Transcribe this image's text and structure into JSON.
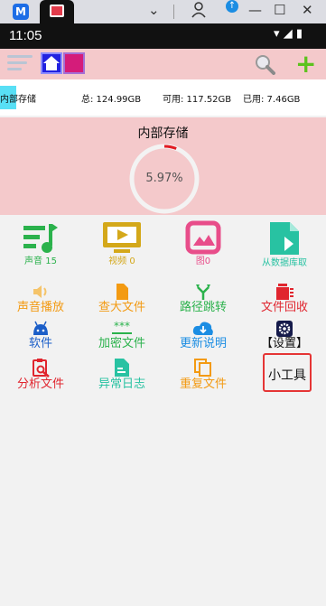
{
  "emulator": {
    "app_badge": "M",
    "controls": {
      "chevron": "⌄",
      "minimize": "—",
      "maximize": "☐",
      "close": "✕"
    }
  },
  "status_bar": {
    "time": "11:05",
    "icons": "▾ ◢ ▮"
  },
  "storage": {
    "name": "内部存储",
    "total": "总: 124.99GB",
    "free": "可用: 117.52GB",
    "used": "已用: 7.46GB",
    "panel_title": "内部存储",
    "percent_text": "5.97%",
    "percent_value": 5.97
  },
  "grid": [
    {
      "label": "声音 15",
      "color": "#2bb24c",
      "icon": "music-icon"
    },
    {
      "label": "视频 0",
      "color": "#d4a81a",
      "icon": "video-icon"
    },
    {
      "label": "图0",
      "color": "#e84d8a",
      "icon": "image-icon"
    },
    {
      "label": "从数据库取",
      "color": "#28c2a2",
      "icon": "database-file-icon"
    },
    {
      "label": "声音播放",
      "color": "#f39a12",
      "icon": "volume-icon"
    },
    {
      "label": "查大文件",
      "color": "#f39a12",
      "icon": "file-icon"
    },
    {
      "label": "路径跳转",
      "color": "#2bb24c",
      "icon": "fork-icon"
    },
    {
      "label": "文件回收",
      "color": "#e0252e",
      "icon": "trash-icon"
    },
    {
      "label": "软件",
      "color": "#1b5ec8",
      "icon": "android-icon"
    },
    {
      "label": "加密文件",
      "color": "#2bb24c",
      "icon": "password-icon"
    },
    {
      "label": "更新说明",
      "color": "#1b8de3",
      "icon": "download-cloud-icon"
    },
    {
      "label": "【设置】",
      "color": "#111111",
      "icon": "gear-icon"
    },
    {
      "label": "分析文件",
      "color": "#e0252e",
      "icon": "analyze-icon"
    },
    {
      "label": "异常日志",
      "color": "#28c2a2",
      "icon": "log-icon"
    },
    {
      "label": "重复文件",
      "color": "#f39a12",
      "icon": "copy-icon"
    },
    {
      "label": "小工具",
      "color": "#111111",
      "icon": ""
    }
  ]
}
